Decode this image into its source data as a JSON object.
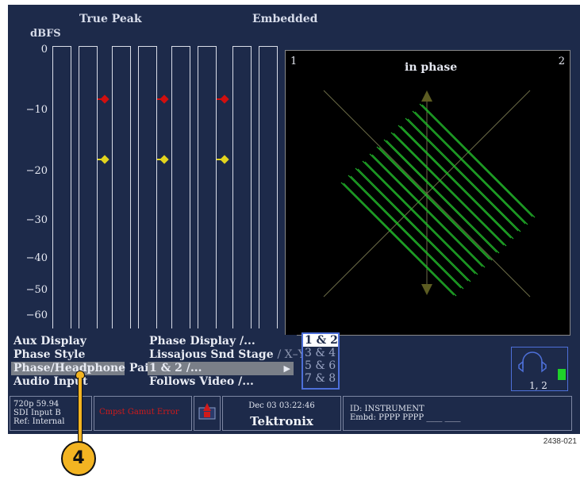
{
  "header": {
    "true_peak": "True Peak",
    "embedded": "Embedded",
    "unit": "dBFS"
  },
  "yaxis": [
    "0",
    "−10",
    "−20",
    "−30",
    "−40",
    "−50",
    "−60"
  ],
  "phase_display": {
    "left_channel": "1",
    "right_channel": "2",
    "label": "in phase"
  },
  "menu": {
    "col1": [
      "Aux Display",
      "Phase Style",
      "Phase/Headphone Pair",
      "Audio Input"
    ],
    "col2": [
      "Phase Display /...",
      "Lissajous Snd Stage",
      "/ X–Y",
      "1 & 2 /...",
      "Follows Video /..."
    ]
  },
  "pairs": [
    "1 & 2",
    "3 & 4",
    "5 & 6",
    "7 & 8"
  ],
  "headphone": {
    "label": "1, 2"
  },
  "status": {
    "format": "720p 59.94",
    "input": "SDI Input B",
    "ref": "Ref: Internal",
    "error": "Cmpst Gamut Error",
    "datetime": "Dec 03 03:22:46",
    "brand": "Tektronix",
    "id": "ID: INSTRUMENT",
    "embd": "Embd: PPPP PPPP ____ ____"
  },
  "figure_code": "2438-021",
  "callout": "4",
  "colors": {
    "screen_bg": "#1d2a4a",
    "lissajous": "#22b52a",
    "peak_red": "#d10f0f",
    "peak_yellow": "#e2d41e",
    "callout": "#f3b422"
  }
}
